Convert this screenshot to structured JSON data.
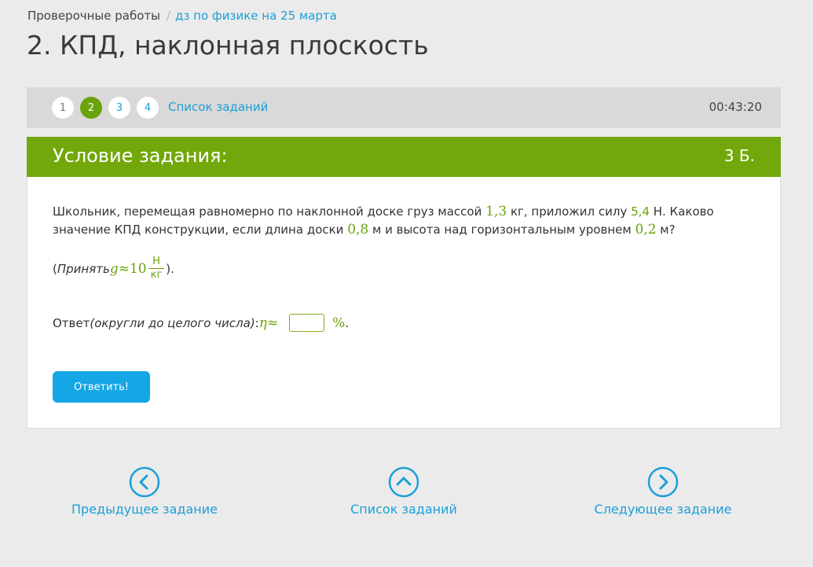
{
  "breadcrumb": {
    "parent": "Проверочные работы",
    "separator": "/",
    "current": "дз по физике на 25 марта"
  },
  "page_title": "2. КПД, наклонная плоскость",
  "task_nav": {
    "steps": [
      {
        "label": "1",
        "state": "done"
      },
      {
        "label": "2",
        "state": "current"
      },
      {
        "label": "3",
        "state": "pending"
      },
      {
        "label": "4",
        "state": "pending"
      }
    ],
    "task_list_label": "Список заданий",
    "timer": "00:43:20"
  },
  "card": {
    "title": "Условие задания:",
    "points": "3 Б.",
    "problem": {
      "t1": "Школьник, перемещая равномерно по наклонной доске груз массой ",
      "mass": "1,3",
      "t2": " кг, приложил силу ",
      "force": "5,4",
      "t3": " Н. Каково значение КПД конструкции, если длина доски ",
      "length": "0,8",
      "t4": " м и высота над горизонтальным уровнем ",
      "height": "0,2",
      "t5": " м?"
    },
    "given": {
      "open": "(",
      "text": "Принять",
      "g": "g",
      "approx": " ≈ ",
      "value": "10",
      "unit_num": "Н",
      "unit_den": "кг",
      "close": ")."
    },
    "answer": {
      "label": "Ответ ",
      "hint": "(округли до целого числа)",
      "colon": ": ",
      "symbol": "η",
      "approx": " ≈",
      "input_value": "",
      "unit": "%",
      "period": "."
    },
    "submit_label": "Ответить!"
  },
  "bottom_nav": {
    "prev_label": "Предыдущее задание",
    "list_label": "Список заданий",
    "next_label": "Следующее задание"
  },
  "colors": {
    "accent_green": "#72a80b",
    "link_blue": "#1a9fd8",
    "button_blue": "#15a6e5",
    "background": "#ebebeb"
  }
}
